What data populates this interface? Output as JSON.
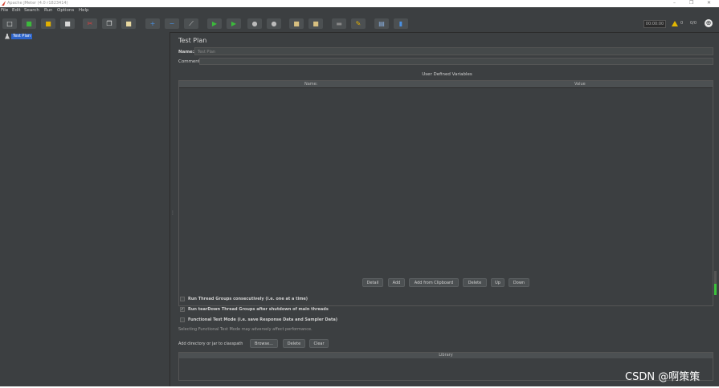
{
  "window": {
    "title": "Apache JMeter (4.0 r1823414)",
    "controls": [
      "–",
      "❐",
      "✕"
    ]
  },
  "menu": [
    "File",
    "Edit",
    "Search",
    "Run",
    "Options",
    "Help"
  ],
  "toolbar": {
    "buttons": [
      {
        "name": "new",
        "icon": "□",
        "color": "#e8e8e8"
      },
      {
        "name": "templates",
        "icon": "■",
        "color": "#3cba3c"
      },
      {
        "name": "open",
        "icon": "■",
        "color": "#e2b000"
      },
      {
        "name": "save",
        "icon": "■",
        "color": "#d8d8d8"
      },
      {
        "name": "cut",
        "icon": "✂",
        "color": "#e04040"
      },
      {
        "name": "copy",
        "icon": "❐",
        "color": "#e8e8e8"
      },
      {
        "name": "paste",
        "icon": "■",
        "color": "#e8d8a0"
      },
      {
        "name": "expand",
        "icon": "+",
        "color": "#4a90e2"
      },
      {
        "name": "collapse",
        "icon": "−",
        "color": "#4a90e2"
      },
      {
        "name": "toggle",
        "icon": "⟋",
        "color": "#cccccc"
      },
      {
        "name": "start",
        "icon": "▶",
        "color": "#3cba3c"
      },
      {
        "name": "start-no-pauses",
        "icon": "▶",
        "color": "#3cba3c"
      },
      {
        "name": "stop",
        "icon": "●",
        "color": "#bbbbbb"
      },
      {
        "name": "shutdown",
        "icon": "●",
        "color": "#bbbbbb"
      },
      {
        "name": "clear",
        "icon": "■",
        "color": "#d8c080"
      },
      {
        "name": "clear-all",
        "icon": "■",
        "color": "#d8c080"
      },
      {
        "name": "search",
        "icon": "▬",
        "color": "#888888"
      },
      {
        "name": "reset-search",
        "icon": "✎",
        "color": "#e2b000"
      },
      {
        "name": "function-helper",
        "icon": "▤",
        "color": "#8ab0e0"
      },
      {
        "name": "help",
        "icon": "▮",
        "color": "#4a90e2"
      }
    ],
    "timer": "00:00:00",
    "warning_count": "0",
    "error_count": "0/0"
  },
  "tree": {
    "root_label": "Test Plan"
  },
  "panel": {
    "title": "Test Plan",
    "name_label": "Name:",
    "name_value": "Test Plan",
    "comments_label": "Comments:",
    "udv_title": "User Defined Variables",
    "columns": [
      "Name:",
      "Value"
    ],
    "buttons": [
      "Detail",
      "Add",
      "Add from Clipboard",
      "Delete",
      "Up",
      "Down"
    ],
    "options": [
      {
        "label": "Run Thread Groups consecutively (i.e. one at a time)",
        "checked": false
      },
      {
        "label": "Run tearDown Thread Groups after shutdown of main threads",
        "checked": true
      },
      {
        "label": "Functional Test Mode (i.e. save Response Data and Sampler Data)",
        "checked": false
      }
    ],
    "functional_note": "Selecting Functional Test Mode may adversely affect performance.",
    "classpath_label": "Add directory or jar to classpath",
    "classpath_buttons": [
      "Browse...",
      "Delete",
      "Clear"
    ],
    "library_header": "Library"
  },
  "watermark": "CSDN @啊策策"
}
